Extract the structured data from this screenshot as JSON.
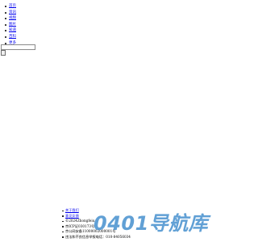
{
  "nav": {
    "items": [
      {
        "label": "首页"
      },
      {
        "label": "资讯"
      },
      {
        "label": "视频"
      },
      {
        "label": "图片"
      },
      {
        "label": "知道"
      },
      {
        "label": "百科"
      },
      {
        "label": "更多"
      }
    ]
  },
  "search": {
    "placeholder": "",
    "value": "",
    "button_label": ""
  },
  "footer": {
    "links": [
      {
        "label": "关于我们"
      },
      {
        "label": "意见反馈"
      }
    ],
    "texts": [
      "©2024Zhongfeiu",
      "京ICP证030173号",
      "京公网安备11000002000001号",
      "违法和不良信息举报电话：010-84056034"
    ]
  },
  "watermark": {
    "text": "0401导航库"
  },
  "colors": {
    "link": "#0000ee",
    "watermark": "#3f8ccd"
  }
}
